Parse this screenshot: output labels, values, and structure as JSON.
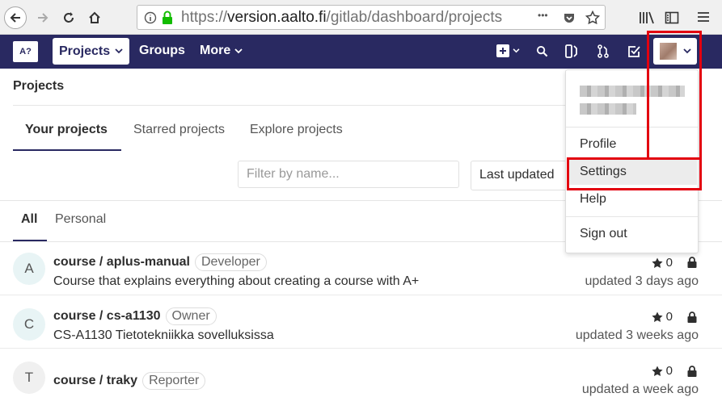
{
  "browser": {
    "url_prefix": "https://",
    "url_host": "version.aalto.fi",
    "url_path": "/gitlab/dashboard/projects",
    "more_label": "•••"
  },
  "nav": {
    "logo": "A?",
    "projects": "Projects",
    "groups": "Groups",
    "more": "More"
  },
  "page": {
    "title": "Projects",
    "tabs": [
      "Your projects",
      "Starred projects",
      "Explore projects"
    ],
    "filter_placeholder": "Filter by name...",
    "sort_label": "Last updated",
    "subtabs": [
      "All",
      "Personal"
    ]
  },
  "projects": [
    {
      "initial": "A",
      "name": "course / aplus-manual",
      "role": "Developer",
      "description": "Course that explains everything about creating a course with A+",
      "stars": "0",
      "updated": "updated 3 days ago",
      "avatar_color": "#e8f4f5"
    },
    {
      "initial": "C",
      "name": "course / cs-a1130",
      "role": "Owner",
      "description": "CS-A1130 Tietotekniikka sovelluksissa",
      "stars": "0",
      "updated": "updated 3 weeks ago",
      "avatar_color": "#e8f4f5"
    },
    {
      "initial": "T",
      "name": "course / traky",
      "role": "Reporter",
      "description": "",
      "stars": "0",
      "updated": "updated a week ago",
      "avatar_color": "#f0f0f0"
    }
  ],
  "user_menu": {
    "items": [
      "Profile",
      "Settings",
      "Help",
      "Sign out"
    ]
  },
  "colors": {
    "nav_bg": "#292961",
    "highlight": "#e3000f"
  }
}
